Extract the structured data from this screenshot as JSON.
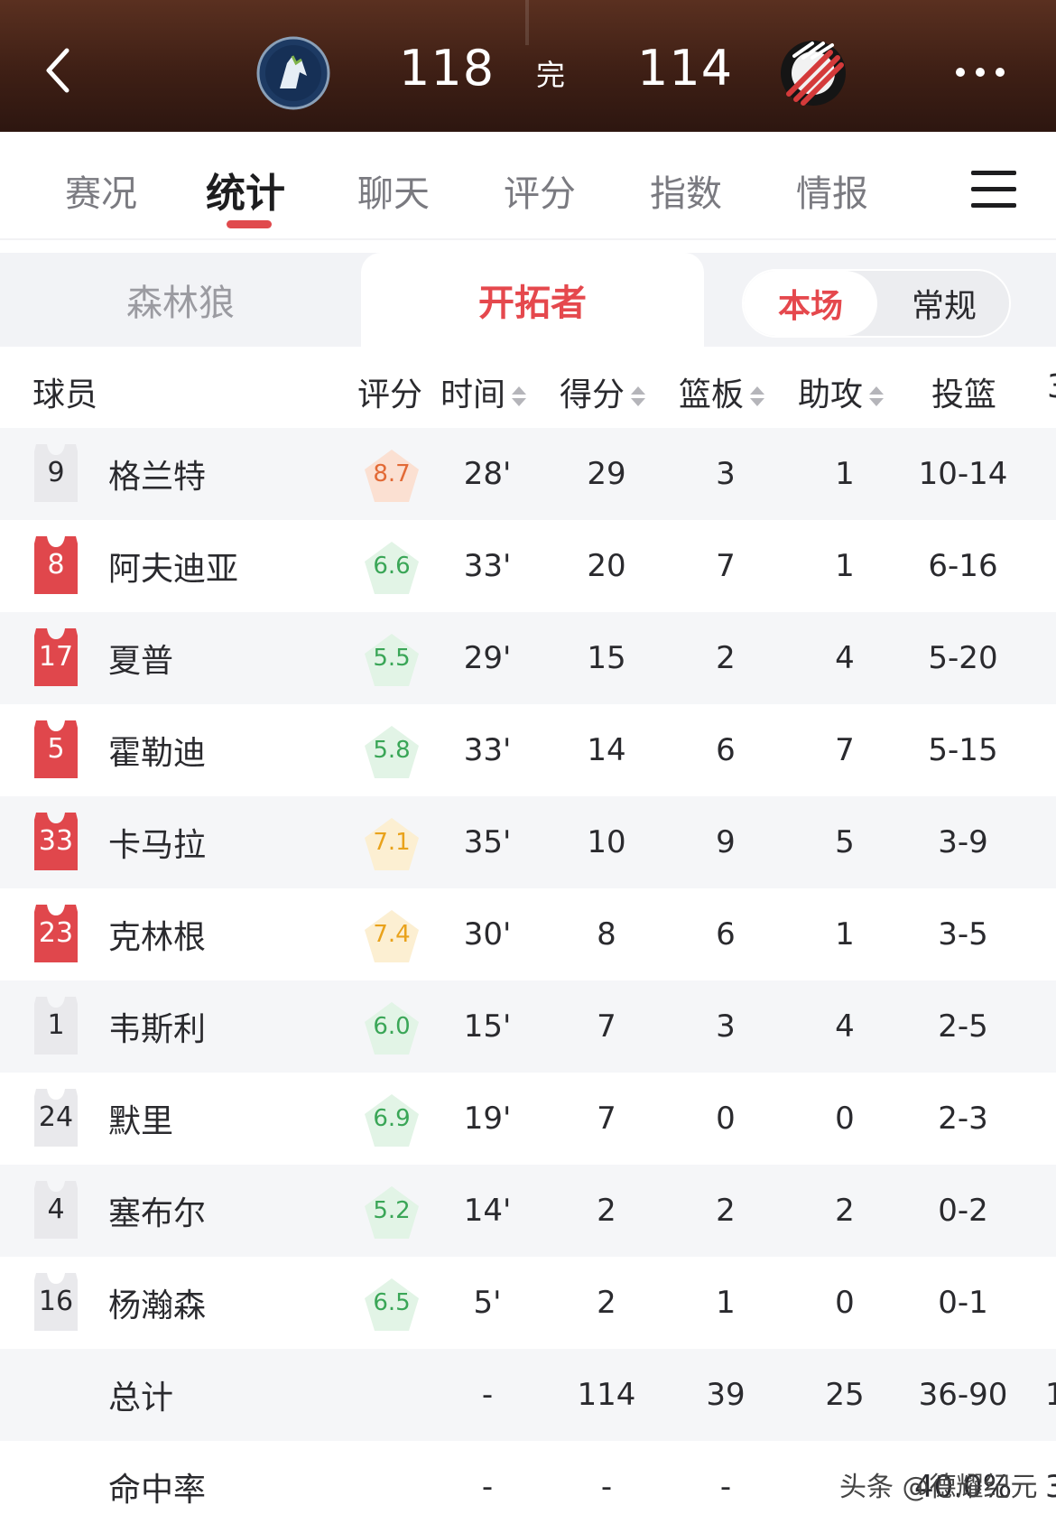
{
  "header": {
    "home_score": "118",
    "status": "完",
    "away_score": "114",
    "home_logo_icon": "wolf-logo-icon",
    "away_logo_icon": "blazers-logo-icon"
  },
  "tabs": [
    {
      "label": "赛况",
      "active": false
    },
    {
      "label": "统计",
      "active": true
    },
    {
      "label": "聊天",
      "active": false
    },
    {
      "label": "评分",
      "active": false
    },
    {
      "label": "指数",
      "active": false
    },
    {
      "label": "情报",
      "active": false
    }
  ],
  "team_tabs": {
    "left": "森林狼",
    "right": "开拓者"
  },
  "segment": {
    "on": "本场",
    "off": "常规"
  },
  "columns": {
    "player": "球员",
    "rating": "评分",
    "time": "时间",
    "points": "得分",
    "rebounds": "篮板",
    "assists": "助攻",
    "fg": "投篮",
    "partial_next": "3"
  },
  "players": [
    {
      "number": "9",
      "name": "格兰特",
      "rating": "8.7",
      "tier": "orange",
      "starter": false,
      "time": "28'",
      "points": "29",
      "rebounds": "3",
      "assists": "1",
      "fg": "10-14"
    },
    {
      "number": "8",
      "name": "阿夫迪亚",
      "rating": "6.6",
      "tier": "green",
      "starter": true,
      "time": "33'",
      "points": "20",
      "rebounds": "7",
      "assists": "1",
      "fg": "6-16"
    },
    {
      "number": "17",
      "name": "夏普",
      "rating": "5.5",
      "tier": "green",
      "starter": true,
      "time": "29'",
      "points": "15",
      "rebounds": "2",
      "assists": "4",
      "fg": "5-20"
    },
    {
      "number": "5",
      "name": "霍勒迪",
      "rating": "5.8",
      "tier": "green",
      "starter": true,
      "time": "33'",
      "points": "14",
      "rebounds": "6",
      "assists": "7",
      "fg": "5-15"
    },
    {
      "number": "33",
      "name": "卡马拉",
      "rating": "7.1",
      "tier": "yellow",
      "starter": true,
      "time": "35'",
      "points": "10",
      "rebounds": "9",
      "assists": "5",
      "fg": "3-9"
    },
    {
      "number": "23",
      "name": "克林根",
      "rating": "7.4",
      "tier": "yellow",
      "starter": true,
      "time": "30'",
      "points": "8",
      "rebounds": "6",
      "assists": "1",
      "fg": "3-5"
    },
    {
      "number": "1",
      "name": "韦斯利",
      "rating": "6.0",
      "tier": "green",
      "starter": false,
      "time": "15'",
      "points": "7",
      "rebounds": "3",
      "assists": "4",
      "fg": "2-5"
    },
    {
      "number": "24",
      "name": "默里",
      "rating": "6.9",
      "tier": "green",
      "starter": false,
      "time": "19'",
      "points": "7",
      "rebounds": "0",
      "assists": "0",
      "fg": "2-3"
    },
    {
      "number": "4",
      "name": "塞布尔",
      "rating": "5.2",
      "tier": "green",
      "starter": false,
      "time": "14'",
      "points": "2",
      "rebounds": "2",
      "assists": "2",
      "fg": "0-2"
    },
    {
      "number": "16",
      "name": "杨瀚森",
      "rating": "6.5",
      "tier": "green",
      "starter": false,
      "time": "5'",
      "points": "2",
      "rebounds": "1",
      "assists": "0",
      "fg": "0-1"
    }
  ],
  "totals": {
    "label": "总计",
    "time": "-",
    "points": "114",
    "rebounds": "39",
    "assists": "25",
    "fg": "36-90",
    "partial_next": "1"
  },
  "percentage": {
    "label": "命中率",
    "time": "-",
    "points": "-",
    "rebounds": "-",
    "fg": "40.0%",
    "partial_next": "3"
  },
  "watermark": "头条 @德耀纪元",
  "colors": {
    "accent_red": "#e5484d",
    "starter_jersey": "#e0474c",
    "bench_jersey": "#e9e9ec",
    "rating_green": "#3aa657",
    "rating_orange": "#e26a36",
    "rating_yellow": "#e9a21b"
  }
}
